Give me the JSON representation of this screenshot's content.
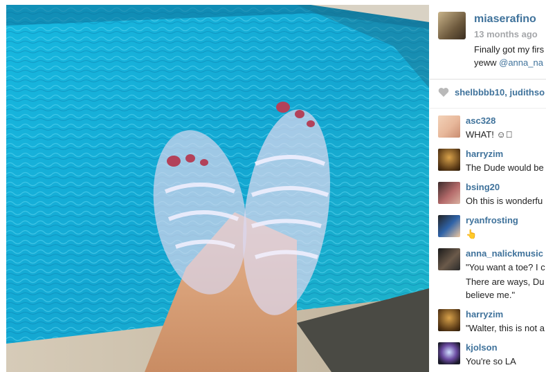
{
  "post": {
    "username": "miaserafino",
    "time": "13 months ago",
    "caption_line1": "Finally got my firs",
    "caption_line2": "yeww ",
    "caption_mention": "@anna_na",
    "likes": "shelbbbb10, judithso"
  },
  "comments": [
    {
      "user": "asc328",
      "text": "WHAT! ☺⃞"
    },
    {
      "user": "harryzim",
      "text": "The Dude would be"
    },
    {
      "user": "bsing20",
      "text": "Oh this is wonderfu"
    },
    {
      "user": "ryanfrosting",
      "text": "👆"
    },
    {
      "user": "anna_nalickmusic",
      "text_line1": "\"You want a toe? I c",
      "text_line2": "There are ways, Du",
      "text_line3": "believe me.\""
    },
    {
      "user": "harryzim",
      "text": "\"Walter, this is not a"
    },
    {
      "user": "kjolson",
      "text": "You're so LA"
    }
  ],
  "colors": {
    "link": "#3f729b",
    "time": "#a5a7aa",
    "pool": "#1ab3d6"
  },
  "icons": {
    "like": "heart-icon"
  }
}
